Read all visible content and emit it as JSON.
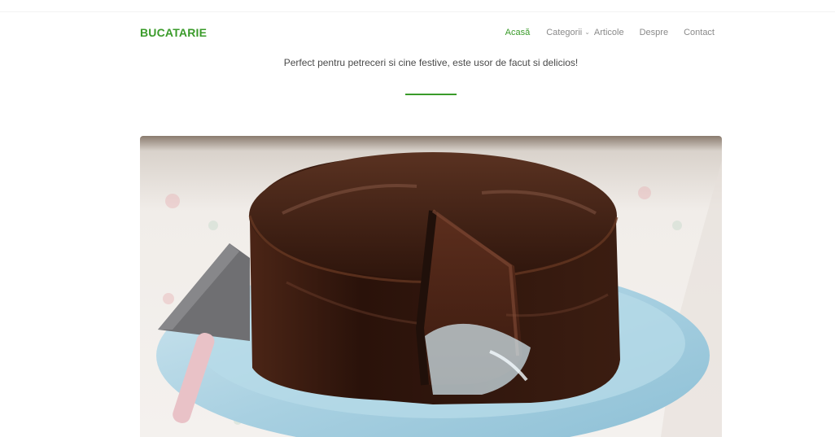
{
  "brand": {
    "logo_text": "BUCATARIE",
    "accent_color": "#3a9b2a"
  },
  "nav": {
    "items": [
      {
        "label": "Acasă",
        "active": true
      },
      {
        "label": "Categorii",
        "has_dropdown": true,
        "dropdown_icon": "chevron-down-icon"
      },
      {
        "label": "Articole"
      },
      {
        "label": "Despre"
      },
      {
        "label": "Contact"
      }
    ]
  },
  "hero": {
    "tagline": "Perfect pentru petreceri si cine festive, este usor de facut si delicios!",
    "image_subject": "chocolate-cake-photo"
  }
}
